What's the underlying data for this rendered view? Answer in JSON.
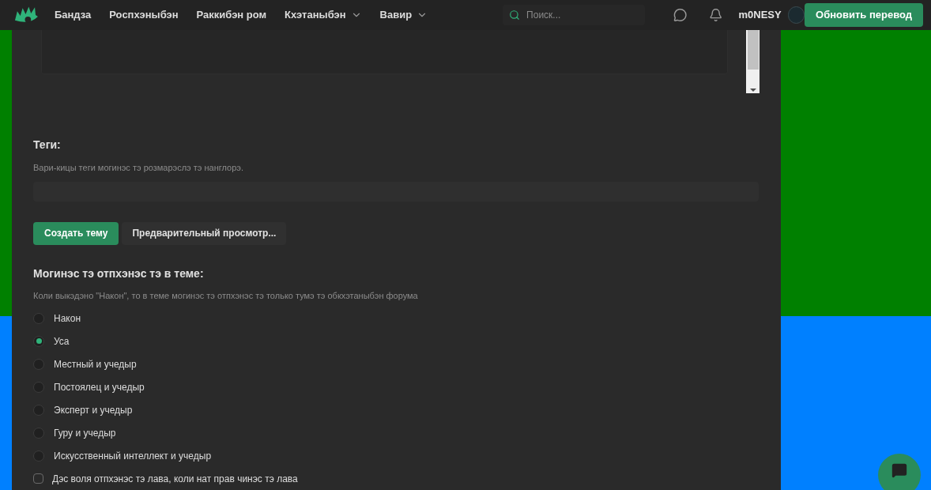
{
  "nav": {
    "items": [
      {
        "label": "Бандза",
        "dropdown": false
      },
      {
        "label": "Роспхэныбэн",
        "dropdown": false
      },
      {
        "label": "Раккибэн ром",
        "dropdown": false
      },
      {
        "label": "Кхэтаныбэн",
        "dropdown": true
      },
      {
        "label": "Вавир",
        "dropdown": true
      }
    ],
    "search": {
      "placeholder": "Поиск..."
    },
    "username": "m0NESY",
    "update_button": "Обновить перевод"
  },
  "tags": {
    "title": "Теги:",
    "hint": "Вари-кицы теги могинэс тэ розмарэслэ тэ нанглорэ."
  },
  "buttons": {
    "create": "Создать тему",
    "preview": "Предварительный просмотр..."
  },
  "reply_access": {
    "title": "Могинэс тэ отпхэнэс тэ в теме:",
    "hint": "Коли выкэдэно \"Након\", то в теме могинэс тэ отпхэнэс тэ только тумэ тэ обкхэтаныбэн форума",
    "options": [
      {
        "label": "Након",
        "selected": false
      },
      {
        "label": "Уса",
        "selected": true
      },
      {
        "label": "Местный и учедыр",
        "selected": false
      },
      {
        "label": "Постоялец и учедыр",
        "selected": false
      },
      {
        "label": "Эксперт и учедыр",
        "selected": false
      },
      {
        "label": "Гуру и учедыр",
        "selected": false
      },
      {
        "label": "Искусственный интеллект и учедыр",
        "selected": false
      }
    ],
    "checkbox": {
      "label": "Дэс воля отпхэнэс тэ лава, коли нат прав чинэс тэ лава",
      "checked": false
    }
  }
}
